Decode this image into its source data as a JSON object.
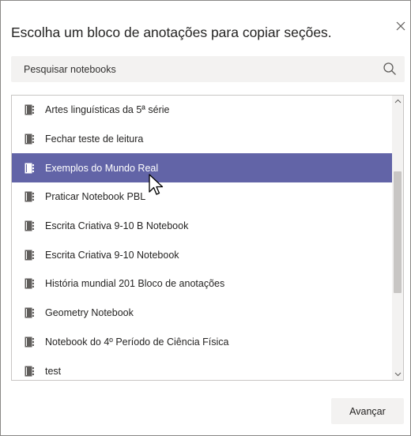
{
  "dialog": {
    "title": "Escolha um bloco de anotações para copiar seções.",
    "close_icon": "close-icon"
  },
  "search": {
    "placeholder": "Pesquisar notebooks",
    "value": "",
    "icon": "search-icon"
  },
  "notebooks": {
    "item_icon": "notebook-icon",
    "selected_index": 2,
    "items": [
      {
        "label": "Artes linguísticas da 5ª série"
      },
      {
        "label": "Fechar teste de leitura"
      },
      {
        "label": "Exemplos do Mundo Real"
      },
      {
        "label": "Praticar Notebook PBL"
      },
      {
        "label": "Escrita Criativa 9-10 B Notebook"
      },
      {
        "label": "Escrita Criativa 9-10 Notebook"
      },
      {
        "label": "História mundial 201   Bloco de anotações"
      },
      {
        "label": "Geometry Notebook"
      },
      {
        "label": "Notebook do 4º Período de Ciência Física"
      },
      {
        "label": "test"
      }
    ]
  },
  "footer": {
    "next_label": "Avançar"
  },
  "colors": {
    "selected_bg": "#6264a7",
    "selected_text": "#ffffff",
    "field_bg": "#f3f2f1"
  }
}
